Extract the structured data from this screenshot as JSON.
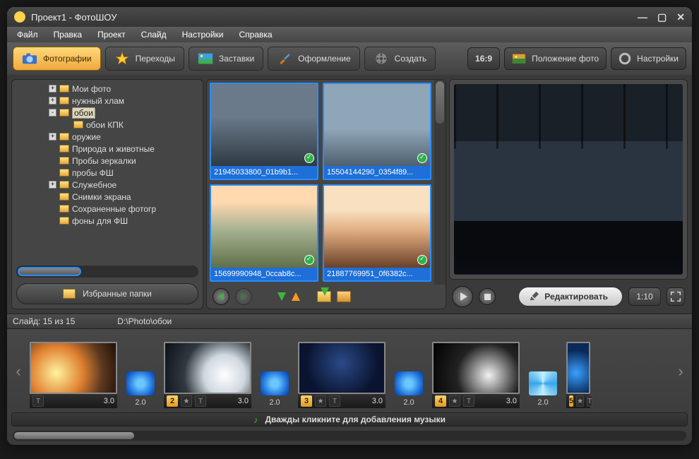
{
  "window": {
    "title": "Проект1 - ФотоШОУ"
  },
  "menu": [
    "Файл",
    "Правка",
    "Проект",
    "Слайд",
    "Настройки",
    "Справка"
  ],
  "tabs": {
    "photos": "Фотографии",
    "transitions": "Переходы",
    "splash": "Заставки",
    "design": "Оформление",
    "create": "Создать"
  },
  "right_tools": {
    "ratio": "16:9",
    "position": "Положение фото",
    "settings": "Настройки"
  },
  "tree": [
    {
      "label": "Мои фото",
      "indent": 0,
      "toggle": "+"
    },
    {
      "label": "нужный хлам",
      "indent": 0,
      "toggle": "+"
    },
    {
      "label": "обои",
      "indent": 0,
      "toggle": "-",
      "selected": true
    },
    {
      "label": "обои КПК",
      "indent": 1
    },
    {
      "label": "оружие",
      "indent": 0,
      "toggle": "+"
    },
    {
      "label": "Природа и животные",
      "indent": 0
    },
    {
      "label": "Пробы зеркалки",
      "indent": 0
    },
    {
      "label": "пробы ФШ",
      "indent": 0
    },
    {
      "label": "Служебное",
      "indent": 0,
      "toggle": "+"
    },
    {
      "label": "Снимки экрана",
      "indent": 0
    },
    {
      "label": "Сохраненные фотогр",
      "indent": 0
    },
    {
      "label": "фоны для ФШ",
      "indent": 0
    }
  ],
  "fav_button": "Избранные папки",
  "thumbs": [
    {
      "name": "21945033800_01b9b1...",
      "cls": "car1"
    },
    {
      "name": "15504144290_0354f89...",
      "cls": "car2"
    },
    {
      "name": "15699990948_0ccab8c...",
      "cls": "car3"
    },
    {
      "name": "21887769951_0f6382c...",
      "cls": "car4"
    }
  ],
  "edit_button": "Редактировать",
  "preview_time": "1:10",
  "slide_info": "Слайд: 15 из 15",
  "path": "D:\\Photo\\обои",
  "timeline": {
    "slides": [
      {
        "cls": "s0",
        "num": "",
        "dur": "3.0",
        "t_after": "2.0",
        "t_cls": ""
      },
      {
        "cls": "s1",
        "num": "2",
        "dur": "3.0",
        "t_after": "2.0",
        "t_cls": ""
      },
      {
        "cls": "s2",
        "num": "3",
        "dur": "3.0",
        "t_after": "2.0",
        "t_cls": ""
      },
      {
        "cls": "s3",
        "num": "4",
        "dur": "3.0",
        "t_after": "2.0",
        "t_cls": "swirl"
      },
      {
        "cls": "s4",
        "num": "5",
        "dur": "",
        "t_after": "",
        "t_cls": ""
      }
    ]
  },
  "music_hint": "Дважды кликните для добавления музыки"
}
